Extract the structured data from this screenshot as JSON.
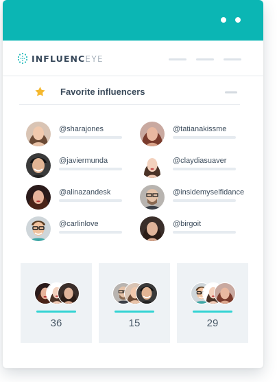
{
  "window": {
    "titlebar_color": "#0bb6b4",
    "controls": [
      "dot",
      "dot"
    ]
  },
  "header": {
    "logo_prefix": "INFLUENC",
    "logo_suffix": "EYE",
    "logo_icon": "dotted-circle-icon",
    "nav_placeholders": 3
  },
  "section": {
    "icon": "star-icon",
    "title": "Favorite influencers",
    "menu_icon": "menu-line-icon"
  },
  "influencers": [
    {
      "handle": "@sharajones"
    },
    {
      "handle": "@tatianakissme"
    },
    {
      "handle": "@javiermunda"
    },
    {
      "handle": "@claydiasuaver"
    },
    {
      "handle": "@alinazandesk"
    },
    {
      "handle": "@insidemyselfidance"
    },
    {
      "handle": "@carlinlove"
    },
    {
      "handle": "@birgoit"
    }
  ],
  "stats": [
    {
      "count": "36"
    },
    {
      "count": "15"
    },
    {
      "count": "29"
    }
  ],
  "colors": {
    "accent": "#0bb6b4",
    "stat_accent": "#32d3d3",
    "star": "#f5b82e"
  }
}
